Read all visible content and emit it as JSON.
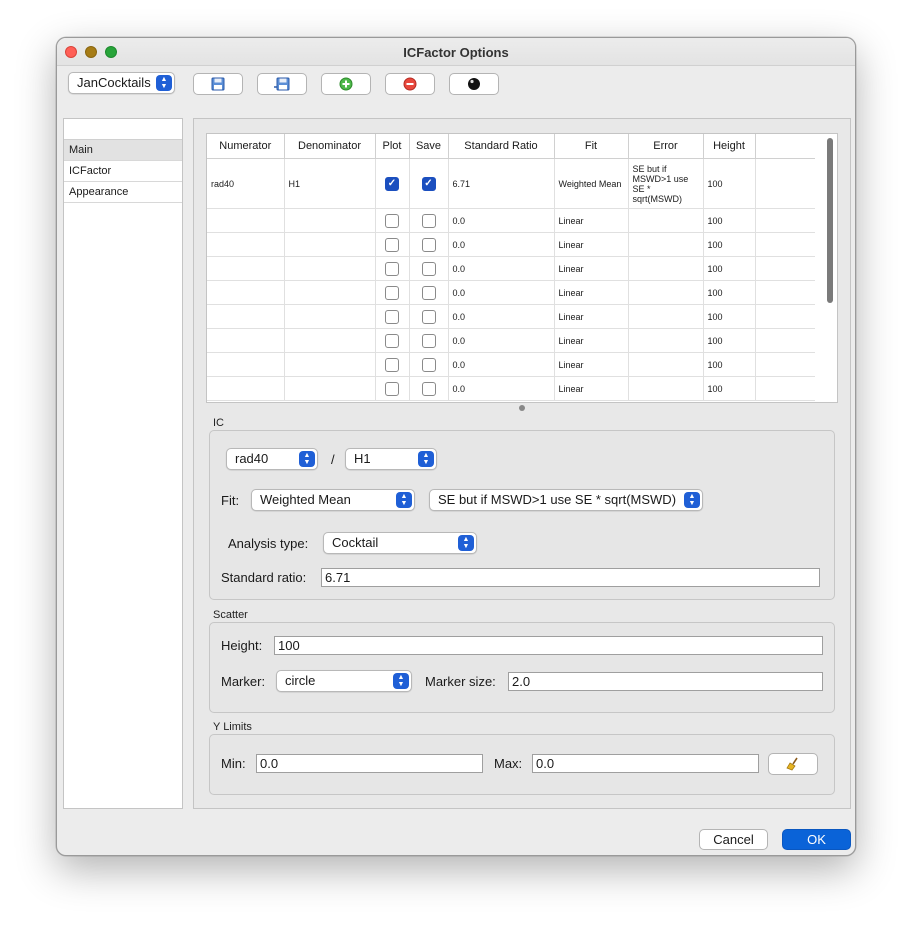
{
  "window": {
    "title": "ICFactor Options"
  },
  "toolbar": {
    "profile": "JanCocktails",
    "buttons": [
      {
        "name": "save-icon"
      },
      {
        "name": "save-as-icon"
      },
      {
        "name": "add-icon"
      },
      {
        "name": "remove-icon"
      },
      {
        "name": "ball-icon"
      }
    ]
  },
  "sidebar": {
    "items": [
      {
        "label": "Main",
        "selected": true
      },
      {
        "label": "ICFactor",
        "selected": false
      },
      {
        "label": "Appearance",
        "selected": false
      }
    ]
  },
  "table": {
    "columns": [
      "Numerator",
      "Denominator",
      "Plot",
      "Save",
      "Standard Ratio",
      "Fit",
      "Error",
      "Height"
    ],
    "rows": [
      {
        "numerator": "rad40",
        "denominator": "H1",
        "plot": true,
        "save": true,
        "ratio": "6.71",
        "fit": "Weighted Mean",
        "error": "SE but if MSWD>1 use SE * sqrt(MSWD)",
        "height": "100"
      },
      {
        "numerator": "",
        "denominator": "",
        "plot": false,
        "save": false,
        "ratio": "0.0",
        "fit": "Linear",
        "error": "",
        "height": "100"
      },
      {
        "numerator": "",
        "denominator": "",
        "plot": false,
        "save": false,
        "ratio": "0.0",
        "fit": "Linear",
        "error": "",
        "height": "100"
      },
      {
        "numerator": "",
        "denominator": "",
        "plot": false,
        "save": false,
        "ratio": "0.0",
        "fit": "Linear",
        "error": "",
        "height": "100"
      },
      {
        "numerator": "",
        "denominator": "",
        "plot": false,
        "save": false,
        "ratio": "0.0",
        "fit": "Linear",
        "error": "",
        "height": "100"
      },
      {
        "numerator": "",
        "denominator": "",
        "plot": false,
        "save": false,
        "ratio": "0.0",
        "fit": "Linear",
        "error": "",
        "height": "100"
      },
      {
        "numerator": "",
        "denominator": "",
        "plot": false,
        "save": false,
        "ratio": "0.0",
        "fit": "Linear",
        "error": "",
        "height": "100"
      },
      {
        "numerator": "",
        "denominator": "",
        "plot": false,
        "save": false,
        "ratio": "0.0",
        "fit": "Linear",
        "error": "",
        "height": "100"
      },
      {
        "numerator": "",
        "denominator": "",
        "plot": false,
        "save": false,
        "ratio": "0.0",
        "fit": "Linear",
        "error": "",
        "height": "100"
      }
    ]
  },
  "ic": {
    "label": "IC",
    "numerator": "rad40",
    "slash": "/",
    "denominator": "H1",
    "fit_label": "Fit:",
    "fit_value": "Weighted Mean",
    "error_value": "SE but if MSWD>1 use SE * sqrt(MSWD)",
    "analysis_type_label": "Analysis type:",
    "analysis_type_value": "Cocktail",
    "standard_ratio_label": "Standard ratio:",
    "standard_ratio_value": "6.71"
  },
  "scatter": {
    "label": "Scatter",
    "height_label": "Height:",
    "height_value": "100",
    "marker_label": "Marker:",
    "marker_value": "circle",
    "marker_size_label": "Marker size:",
    "marker_size_value": "2.0"
  },
  "ylimits": {
    "label": "Y Limits",
    "min_label": "Min:",
    "min_value": "0.0",
    "max_label": "Max:",
    "max_value": "0.0"
  },
  "footer": {
    "cancel": "Cancel",
    "ok": "OK"
  },
  "colors": {
    "accent": "#1f5fd6",
    "ok_button": "#0a63d8",
    "arrow": "#f0361a",
    "close": "#ff5f57",
    "minimize": "#a67c16",
    "zoom": "#28a43a"
  }
}
